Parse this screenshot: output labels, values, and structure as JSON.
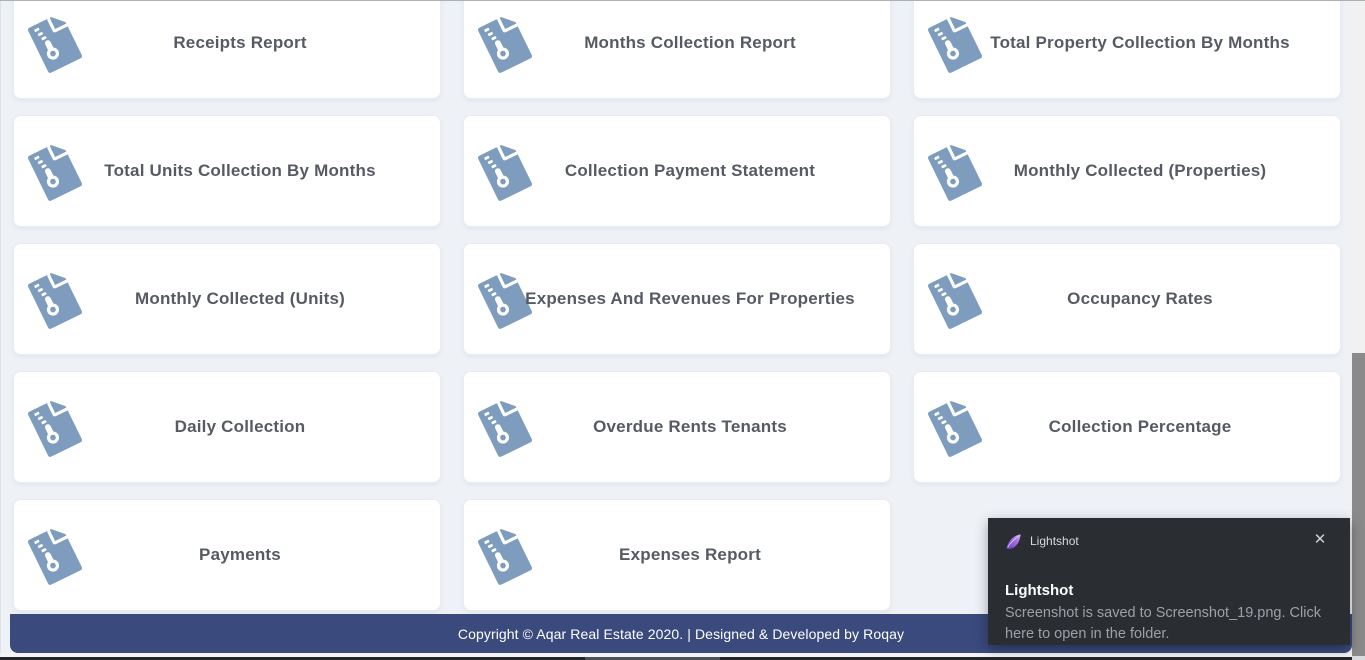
{
  "colors": {
    "page_bg": "#eef2f7",
    "card_bg": "#ffffff",
    "icon": "#7e9cbe",
    "title": "#565b63",
    "footer_bg": "#3a4a7d",
    "footer_text": "#ffffff",
    "toast_bg": "#2a2d32",
    "scroll_thumb": "#8a8a8a"
  },
  "cards": [
    {
      "title": "Receipts Report"
    },
    {
      "title": "Months Collection Report"
    },
    {
      "title": "Total Property Collection By Months"
    },
    {
      "title": "Total Units Collection By Months"
    },
    {
      "title": "Collection Payment Statement"
    },
    {
      "title": "Monthly Collected (Properties)"
    },
    {
      "title": "Monthly Collected (Units)"
    },
    {
      "title": "Expenses And Revenues For Properties"
    },
    {
      "title": "Occupancy Rates"
    },
    {
      "title": "Daily Collection"
    },
    {
      "title": "Overdue Rents Tenants"
    },
    {
      "title": "Collection Percentage"
    },
    {
      "title": "Payments"
    },
    {
      "title": "Expenses Report"
    }
  ],
  "card_icon": "file-zipper-icon",
  "footer": {
    "text": "Copyright © Aqar Real Estate 2020. | Designed & Developed by Roqay"
  },
  "toast": {
    "app_name": "Lightshot",
    "app_icon": "lightshot-feather-icon",
    "close_glyph": "✕",
    "title": "Lightshot",
    "message": "Screenshot is saved to Screenshot_19.png. Click here to open in the folder."
  }
}
